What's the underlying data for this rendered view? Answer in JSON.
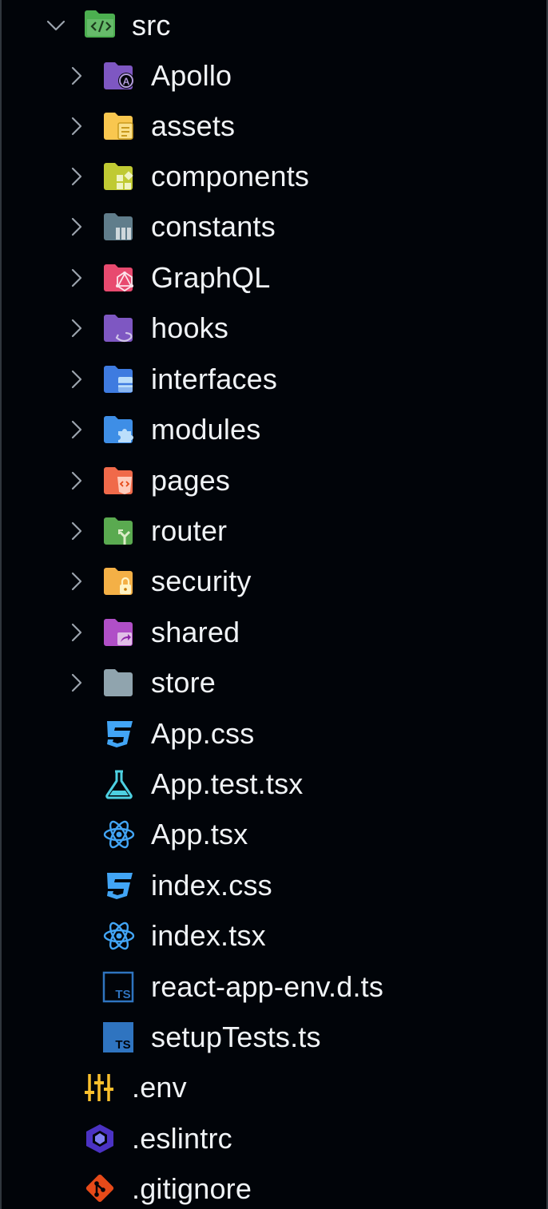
{
  "explorer": {
    "root_folder": {
      "label": "src",
      "expanded": true
    },
    "folders": [
      {
        "label": "Apollo",
        "icon": "folder-apollo-icon",
        "color": "#7e57c2"
      },
      {
        "label": "assets",
        "icon": "folder-assets-icon",
        "color": "#f9c74f"
      },
      {
        "label": "components",
        "icon": "folder-components-icon",
        "color": "#c0ca33"
      },
      {
        "label": "constants",
        "icon": "folder-constants-icon",
        "color": "#607d8b"
      },
      {
        "label": "GraphQL",
        "icon": "folder-graphql-icon",
        "color": "#e84a6f"
      },
      {
        "label": "hooks",
        "icon": "folder-hooks-icon",
        "color": "#7e57c2"
      },
      {
        "label": "interfaces",
        "icon": "folder-interfaces-icon",
        "color": "#3e7be0"
      },
      {
        "label": "modules",
        "icon": "folder-modules-icon",
        "color": "#3e8ee6"
      },
      {
        "label": "pages",
        "icon": "folder-pages-icon",
        "color": "#f06a4a"
      },
      {
        "label": "router",
        "icon": "folder-router-icon",
        "color": "#5aaa50"
      },
      {
        "label": "security",
        "icon": "folder-security-icon",
        "color": "#f4b046"
      },
      {
        "label": "shared",
        "icon": "folder-shared-icon",
        "color": "#b04fc7"
      },
      {
        "label": "store",
        "icon": "folder-icon",
        "color": "#90a4ae"
      }
    ],
    "files": [
      {
        "label": "App.css",
        "icon": "css-icon"
      },
      {
        "label": "App.test.tsx",
        "icon": "test-flask-icon"
      },
      {
        "label": "App.tsx",
        "icon": "react-icon"
      },
      {
        "label": "index.css",
        "icon": "css-icon"
      },
      {
        "label": "index.tsx",
        "icon": "react-icon"
      },
      {
        "label": "react-app-env.d.ts",
        "icon": "typescript-def-icon"
      },
      {
        "label": "setupTests.ts",
        "icon": "typescript-icon"
      }
    ],
    "root_files": [
      {
        "label": ".env",
        "icon": "env-settings-icon"
      },
      {
        "label": ".eslintrc",
        "icon": "eslint-icon"
      },
      {
        "label": ".gitignore",
        "icon": "git-icon"
      }
    ]
  }
}
